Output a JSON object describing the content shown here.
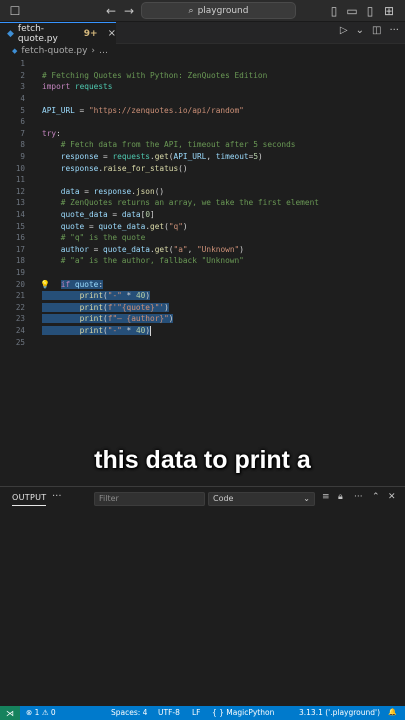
{
  "titlebar": {
    "search_text": "playground",
    "back_icon": "arrow-left-icon",
    "forward_icon": "arrow-right-icon"
  },
  "tab": {
    "filename": "fetch-quote.py",
    "modified": "9+",
    "close": "×"
  },
  "breadcrumb": {
    "file": "fetch-quote.py",
    "more": "…"
  },
  "code_lines": [
    {
      "n": "1",
      "html": ""
    },
    {
      "n": "2",
      "html": "<span class='c-com'># Fetching Quotes with Python: ZenQuotes Edition</span>"
    },
    {
      "n": "3",
      "html": "<span class='c-kw'>import</span> <span class='c-mod'>requests</span>"
    },
    {
      "n": "4",
      "html": ""
    },
    {
      "n": "5",
      "html": "<span class='c-var'>API_URL</span> = <span class='c-str'>\"https://zenquotes.io/api/random\"</span>"
    },
    {
      "n": "6",
      "html": ""
    },
    {
      "n": "7",
      "html": "<span class='c-kw'>try</span>:"
    },
    {
      "n": "8",
      "html": "    <span class='c-com'># Fetch data from the API, timeout after 5 seconds</span>"
    },
    {
      "n": "9",
      "html": "    <span class='c-var'>response</span> = <span class='c-mod'>requests</span>.<span class='c-fn'>get</span>(<span class='c-var'>API_URL</span>, <span class='c-var'>timeout</span>=<span class='c-num'>5</span>)"
    },
    {
      "n": "10",
      "html": "    <span class='c-var'>response</span>.<span class='c-fn'>raise_for_status</span>()"
    },
    {
      "n": "11",
      "html": ""
    },
    {
      "n": "12",
      "html": "    <span class='c-var'>data</span> = <span class='c-var'>response</span>.<span class='c-fn'>json</span>()"
    },
    {
      "n": "13",
      "html": "    <span class='c-com'># ZenQuotes returns an array, we take the first element</span>"
    },
    {
      "n": "14",
      "html": "    <span class='c-var'>quote_data</span> = <span class='c-var'>data</span>[<span class='c-num'>0</span>]"
    },
    {
      "n": "15",
      "html": "    <span class='c-var'>quote</span> = <span class='c-var'>quote_data</span>.<span class='c-fn'>get</span>(<span class='c-str'>\"q\"</span>)"
    },
    {
      "n": "16",
      "html": "    <span class='c-com'># \"q\" is the quote</span>"
    },
    {
      "n": "17",
      "html": "    <span class='c-var'>author</span> = <span class='c-var'>quote_data</span>.<span class='c-fn'>get</span>(<span class='c-str'>\"a\"</span>, <span class='c-str'>\"Unknown\"</span>)"
    },
    {
      "n": "18",
      "html": "    <span class='c-com'># \"a\" is the author, fallback \"Unknown\"</span>"
    },
    {
      "n": "19",
      "html": ""
    },
    {
      "n": "20",
      "html": "    <span class='sel'><span class='c-kw'>if</span> <span class='c-var'>quote</span>:</span>"
    },
    {
      "n": "21",
      "html": "<span class='sel'>        <span class='c-fn'>print</span>(<span class='c-str'>\"-\"</span> * <span class='c-num'>40</span>)</span>"
    },
    {
      "n": "22",
      "html": "<span class='sel'>        <span class='c-fn'>print</span>(<span class='c-str'>f'\"{quote}\"'</span>)</span>"
    },
    {
      "n": "23",
      "html": "<span class='sel'>        <span class='c-fn'>print</span>(<span class='c-str'>f\"— {author}\"</span>)</span>"
    },
    {
      "n": "24",
      "html": "<span class='sel'>        <span class='c-fn'>print</span>(<span class='c-str'>\"-\"</span> * <span class='c-num'>40</span>)</span><span class='cursor'></span>"
    },
    {
      "n": "25",
      "html": ""
    }
  ],
  "caption": "this data to print a",
  "panel": {
    "tab_label": "OUTPUT",
    "more": "···",
    "filter_placeholder": "Filter",
    "select_value": "Code"
  },
  "statusbar": {
    "problems": "⊗ 1 ⚠ 0",
    "spaces": "Spaces: 4",
    "encoding": "UTF-8",
    "eol": "LF",
    "language": "{ } MagicPython",
    "interpreter": "3.13.1 ('.playground')",
    "bell": "🔔"
  },
  "colors": {
    "accent": "#3794ff",
    "statusbar": "#007acc",
    "selection": "#264f78"
  }
}
